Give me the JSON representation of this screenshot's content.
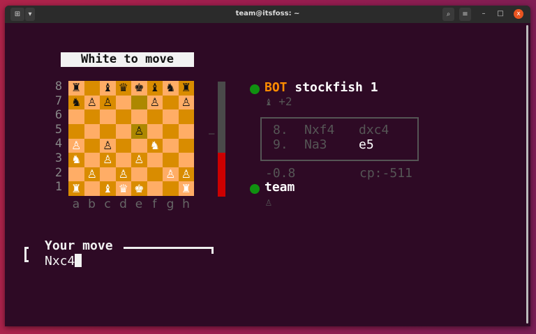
{
  "window": {
    "title": "team@itsfoss: ~"
  },
  "titlebar": {
    "new_tab_icon": "new-tab-icon",
    "dropdown_icon": "chevron-down-icon",
    "search_icon": "search-icon",
    "menu_icon": "hamburger-icon",
    "min": "–",
    "max": "□",
    "close": "x"
  },
  "game": {
    "status": "White to move",
    "ranks": [
      "8",
      "7",
      "6",
      "5",
      "4",
      "3",
      "2",
      "1"
    ],
    "files": [
      "a",
      "b",
      "c",
      "d",
      "e",
      "f",
      "g",
      "h"
    ],
    "board": [
      [
        "br",
        "",
        "bb",
        "bq",
        "bk",
        "bb",
        "bn",
        "br"
      ],
      [
        "bn",
        "bp",
        "bp",
        "",
        "",
        "bp",
        "",
        "bp"
      ],
      [
        "",
        "",
        "",
        "",
        "",
        "",
        "",
        ""
      ],
      [
        "",
        "",
        "",
        "",
        "bp",
        "",
        "",
        ""
      ],
      [
        "wp",
        "",
        "bp",
        "",
        "",
        "wn",
        "",
        ""
      ],
      [
        "wn",
        "",
        "wp",
        "",
        "wp",
        "",
        "",
        ""
      ],
      [
        "",
        "wp",
        "",
        "wp",
        "",
        "",
        "wp",
        "wp"
      ],
      [
        "wr",
        "",
        "wb",
        "wq",
        "wk",
        "",
        "",
        "wr"
      ]
    ],
    "highlighted": [
      "e7",
      "e5"
    ],
    "eval_fraction_white": 0.38,
    "eval_tick": "—",
    "opponent": {
      "tag": "BOT",
      "name": "stockfish 1",
      "captured": "♝",
      "advantage": "+2"
    },
    "moves": [
      {
        "num": "8.",
        "white": "Nxf4",
        "black": "dxc4"
      },
      {
        "num": "9.",
        "white": "Na3",
        "black": "e5"
      }
    ],
    "eval": "-0.8",
    "cp": "cp:-511",
    "player": {
      "name": "team",
      "captured": "♙"
    },
    "input": {
      "label": "Your move",
      "value": "Nxc4"
    }
  },
  "colors": {
    "accent": "#ff8c00",
    "online": "#109010",
    "eval_red": "#cc0000"
  }
}
